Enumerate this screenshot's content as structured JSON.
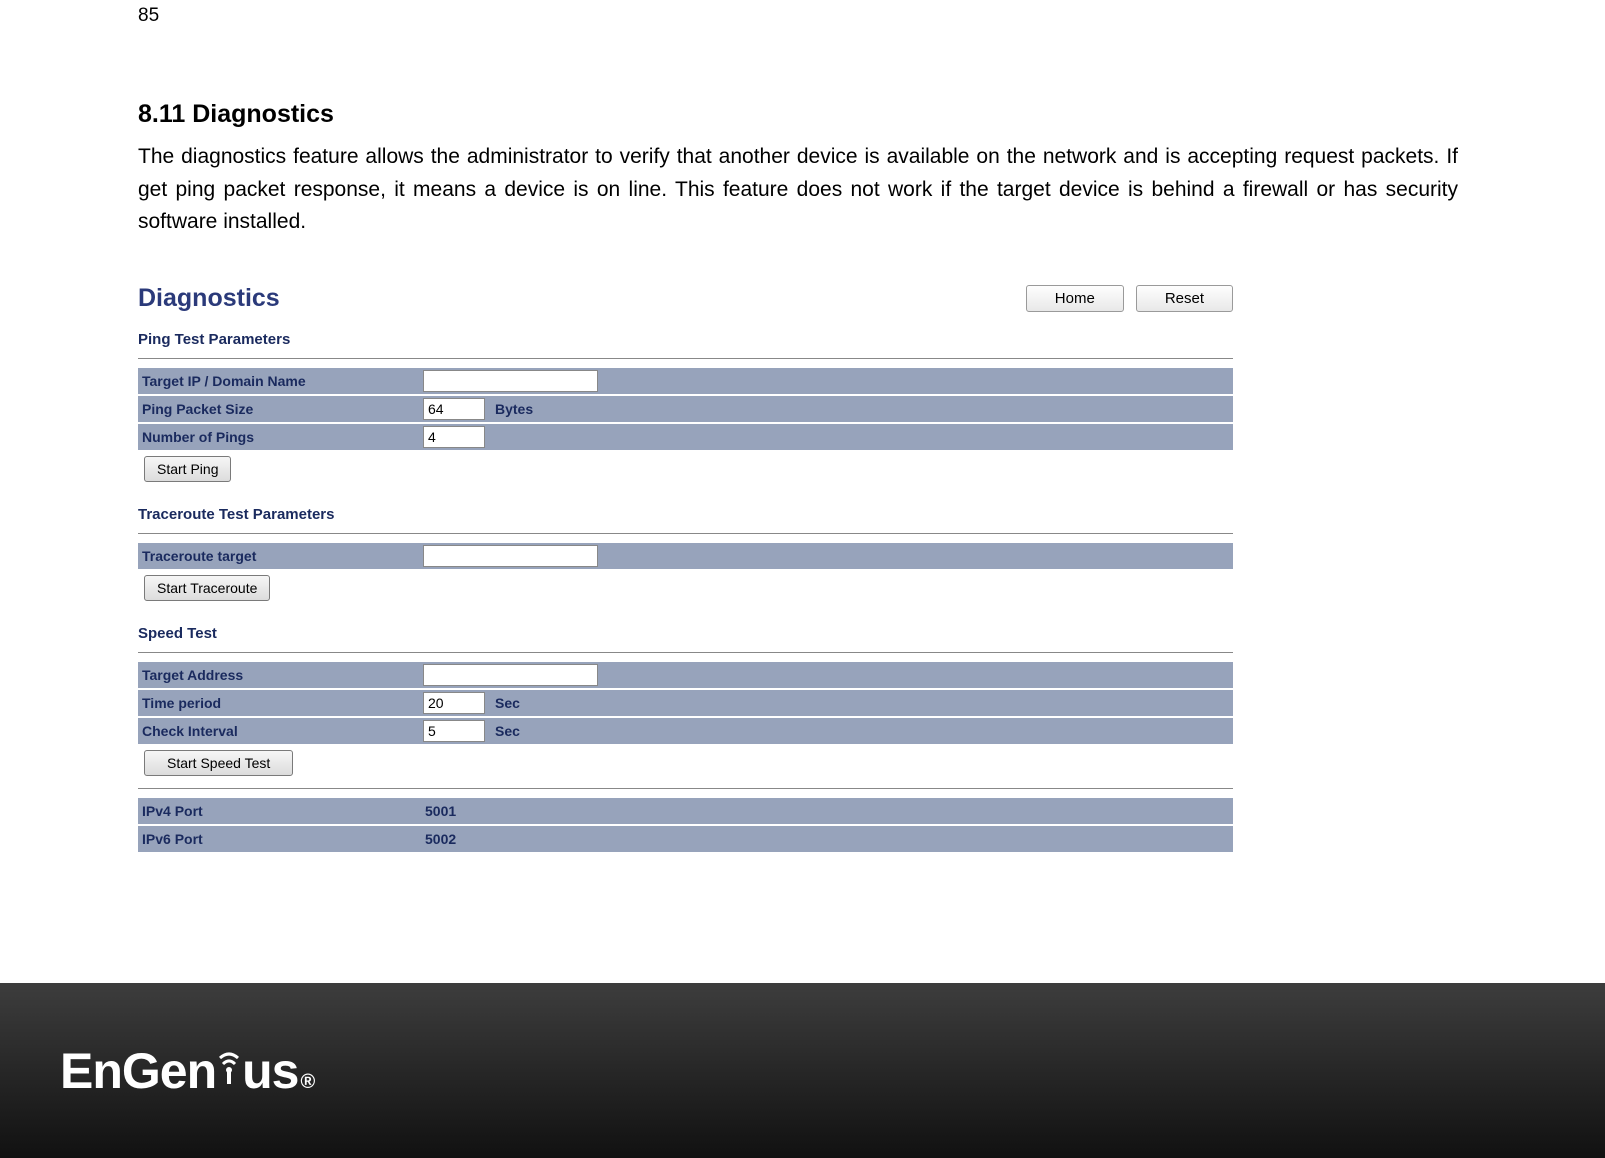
{
  "page_number": "85",
  "section": {
    "title": "8.11 Diagnostics",
    "description": "The diagnostics feature allows the administrator to verify that another device is available on the network and is accepting request packets. If get ping packet response, it means a device is on line. This feature does not work if the target device is behind a firewall or has security software installed."
  },
  "panel": {
    "title": "Diagnostics",
    "buttons": {
      "home": "Home",
      "reset": "Reset"
    },
    "ping": {
      "section_label": "Ping Test Parameters",
      "target_label": "Target IP / Domain Name",
      "target_value": "",
      "packet_size_label": "Ping Packet Size",
      "packet_size_value": "64",
      "packet_size_unit": "Bytes",
      "num_pings_label": "Number of Pings",
      "num_pings_value": "4",
      "start_button": "Start Ping"
    },
    "traceroute": {
      "section_label": "Traceroute Test Parameters",
      "target_label": "Traceroute target",
      "target_value": "",
      "start_button": "Start Traceroute"
    },
    "speed": {
      "section_label": "Speed Test",
      "target_label": "Target Address",
      "target_value": "",
      "time_period_label": "Time period",
      "time_period_value": "20",
      "time_period_unit": "Sec",
      "check_interval_label": "Check Interval",
      "check_interval_value": "5",
      "check_interval_unit": "Sec",
      "start_button": "Start Speed Test"
    },
    "ports": {
      "ipv4_label": "IPv4 Port",
      "ipv4_value": "5001",
      "ipv6_label": "IPv6 Port",
      "ipv6_value": "5002"
    }
  },
  "footer": {
    "logo_text_prefix": "EnGen",
    "logo_text_suffix": "us",
    "logo_registered": "®"
  }
}
